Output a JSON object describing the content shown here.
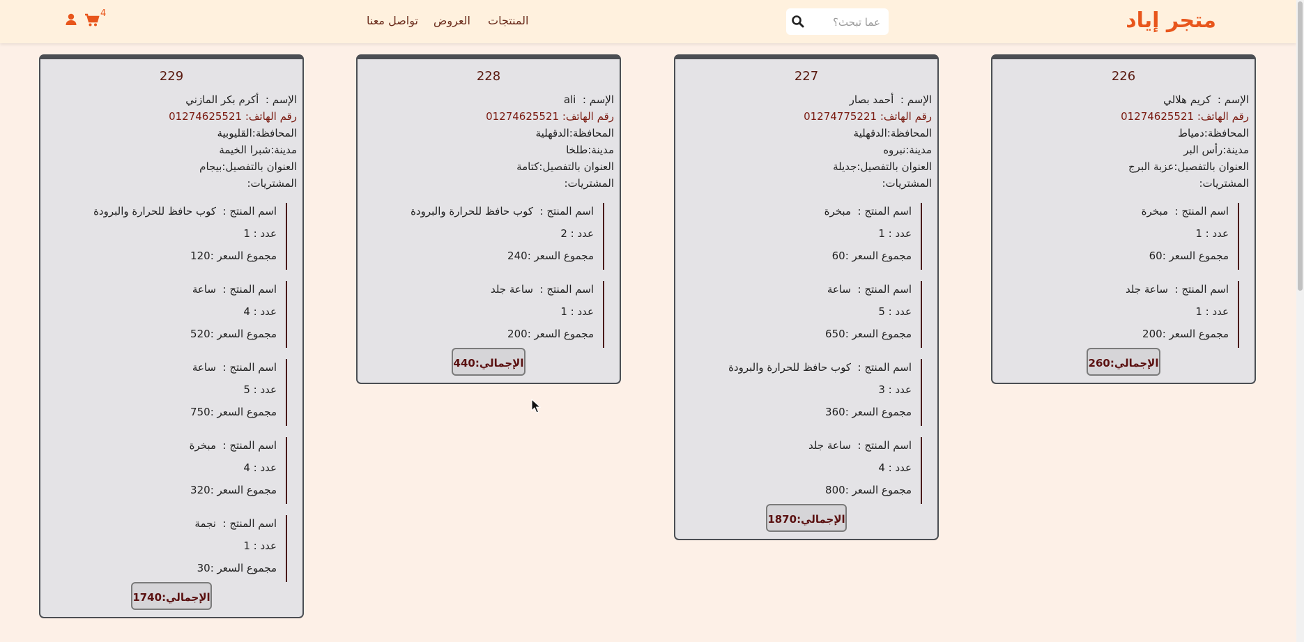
{
  "header": {
    "logo": "متجر إياد",
    "search_placeholder": "عما تبحث؟",
    "nav": [
      "المنتجات",
      "العروض",
      "تواصل معنا"
    ],
    "cart_count": "4"
  },
  "labels": {
    "name": "الإسم :",
    "phone": "رقم الهاتف:",
    "governorate": "المحافظة:",
    "city": "مدينة:",
    "address": "العنوان بالتفصيل:",
    "purchases": "المشتريات:",
    "product": "اسم المنتج :",
    "qty": "عدد :",
    "price": "مجموع السعر :",
    "total": "الإجمالي:"
  },
  "orders": [
    {
      "id": "226",
      "name": "كريم هلالي",
      "phone": "01274625521",
      "governorate": "دمياط",
      "city": "رأس البر",
      "address": "عزبة البرج",
      "items": [
        {
          "product": "مبخرة",
          "qty": "1",
          "price": "60"
        },
        {
          "product": "ساعة جلد",
          "qty": "1",
          "price": "200"
        }
      ],
      "total": "260"
    },
    {
      "id": "227",
      "name": "أحمد بصار",
      "phone": "01274775221",
      "governorate": "الدقهلية",
      "city": "نبروه",
      "address": "جديلة",
      "items": [
        {
          "product": "مبخرة",
          "qty": "1",
          "price": "60"
        },
        {
          "product": "ساعة",
          "qty": "5",
          "price": "650"
        },
        {
          "product": "كوب حافظ للحرارة والبرودة",
          "qty": "3",
          "price": "360"
        },
        {
          "product": "ساعة جلد",
          "qty": "4",
          "price": "800"
        }
      ],
      "total": "1870"
    },
    {
      "id": "228",
      "name": "ali",
      "phone": "01274625521",
      "governorate": "الدقهلية",
      "city": "طلخا",
      "address": "كتامة",
      "items": [
        {
          "product": "كوب حافظ للحرارة والبرودة",
          "qty": "2",
          "price": "240"
        },
        {
          "product": "ساعة جلد",
          "qty": "1",
          "price": "200"
        }
      ],
      "total": "440"
    },
    {
      "id": "229",
      "name": "أكرم بكر المازني",
      "phone": "01274625521",
      "governorate": "القليوبية",
      "city": "شبرا الخيمة",
      "address": "بيجام",
      "items": [
        {
          "product": "كوب حافظ للحرارة والبرودة",
          "qty": "1",
          "price": "120"
        },
        {
          "product": "ساعة",
          "qty": "4",
          "price": "520"
        },
        {
          "product": "ساعة",
          "qty": "5",
          "price": "750"
        },
        {
          "product": "مبخرة",
          "qty": "4",
          "price": "320"
        },
        {
          "product": "نجمة",
          "qty": "1",
          "price": "30"
        }
      ],
      "total": "1740"
    }
  ]
}
